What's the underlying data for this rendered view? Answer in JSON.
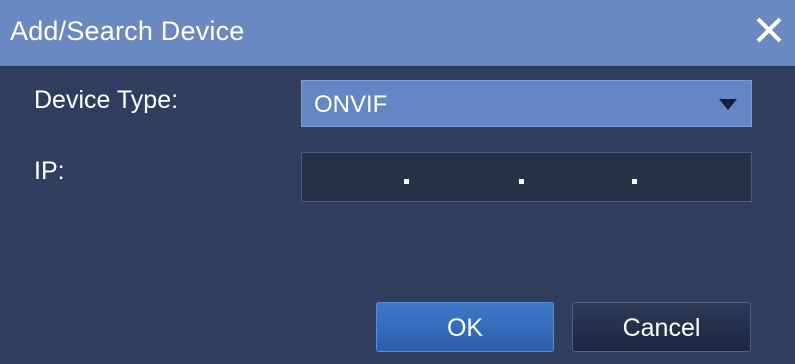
{
  "dialog": {
    "title": "Add/Search Device",
    "close_icon": "close-icon"
  },
  "form": {
    "device_type_label": "Device Type:",
    "device_type_value": "ONVIF",
    "ip_label": "IP:",
    "ip_value": ". . ."
  },
  "buttons": {
    "ok_label": "OK",
    "cancel_label": "Cancel"
  },
  "colors": {
    "titlebar": "#6a88c1",
    "background": "#2f3e5e",
    "select_bg": "#6586c4",
    "ok_button": "#3f78c7"
  }
}
